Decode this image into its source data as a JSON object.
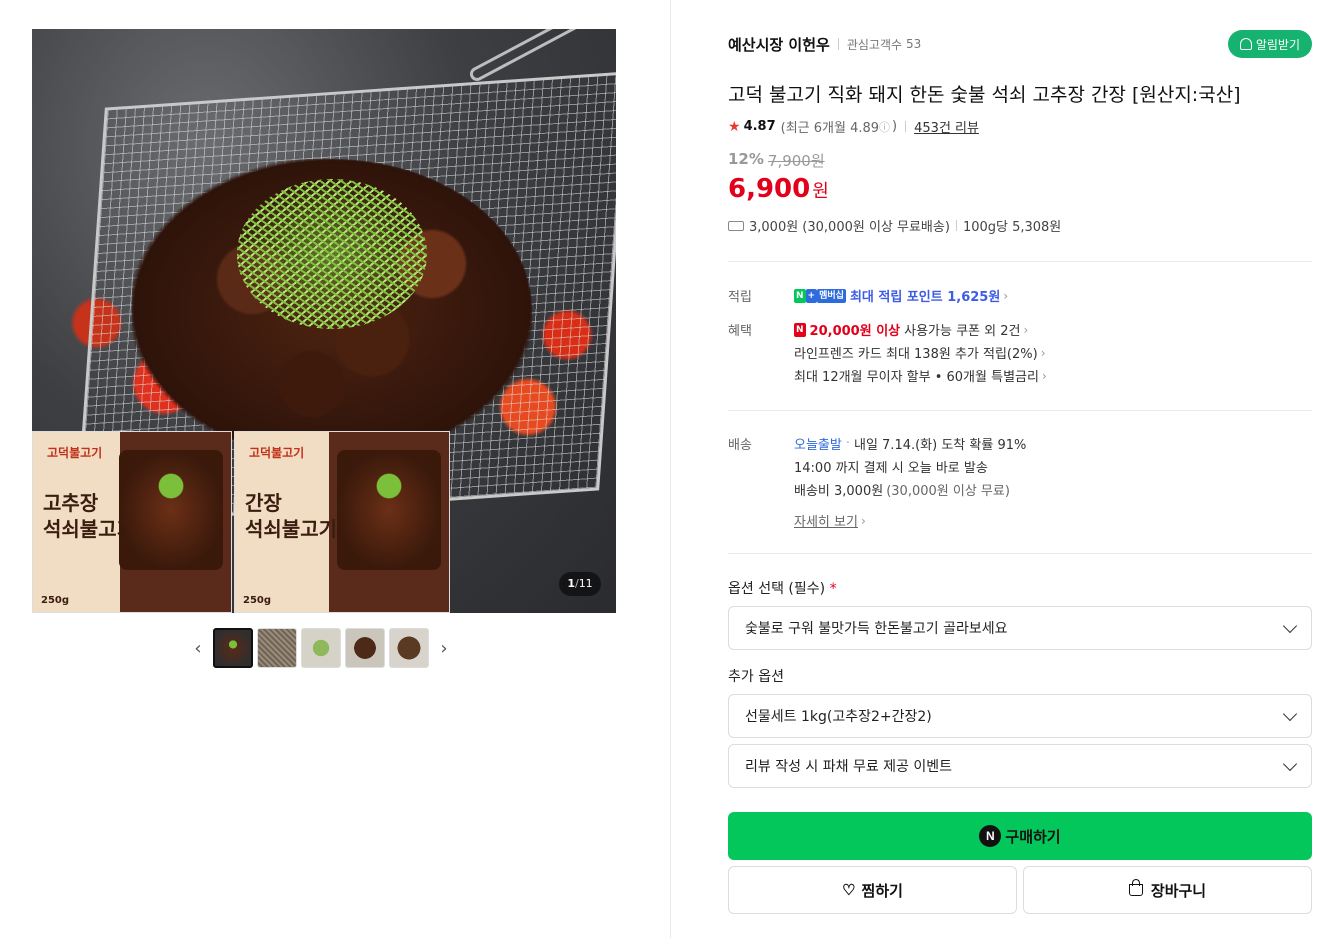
{
  "gallery": {
    "packs": [
      {
        "brand": "고덕불고기",
        "name_line1": "고추장",
        "name_line2": "석쇠불고기",
        "weight": "250g"
      },
      {
        "brand": "고덕불고기",
        "name_line1": "간장",
        "name_line2": "석쇠불고기",
        "weight": "250g"
      }
    ],
    "counter_current": "1",
    "counter_sep": "/",
    "counter_total": "11",
    "prev_icon": "chevron-left-icon",
    "next_icon": "chevron-right-icon"
  },
  "seller": {
    "name": "예산시장 이헌우",
    "interest_label": "관심고객수",
    "interest_count": "53",
    "notify_label": "알림받기"
  },
  "product": {
    "title": "고덕 불고기 직화 돼지 한돈 숯불 석쇠 고추장 간장 [원산지:국산]",
    "rating": "4.87",
    "recent_rating": "(최근 6개월 4.89",
    "recent_close": ")",
    "review_link": "453건 리뷰",
    "discount": "12%",
    "original_price": "7,900원",
    "price": "6,900",
    "currency": "원",
    "shipping": "3,000원 (30,000원 이상 무료배송)",
    "unit_price": "100g당 5,308원"
  },
  "benefits": {
    "points_label": "적립",
    "points_badge_n": "N",
    "points_badge_plus": "+",
    "points_badge_membership": "멤버십",
    "points_text": "최대 적립 포인트 1,625원",
    "benefit_label": "혜택",
    "coupon_badge": "N",
    "coupon_amount": "20,000원 이상",
    "coupon_text": "사용가능 쿠폰 외 2건",
    "card_text": "라인프렌즈 카드 최대 138원 추가 적립(2%)",
    "installment_text": "최대 12개월 무이자 할부 • 60개월 특별금리"
  },
  "delivery": {
    "label": "배송",
    "today": "오늘출발",
    "arrival": "내일 7.14.(화) 도착 확률 91%",
    "cutoff": "14:00 까지 결제 시 오늘 바로 발송",
    "fee": "배송비 3,000원",
    "fee_note": "(30,000원 이상 무료)",
    "detail_link": "자세히 보기"
  },
  "options": {
    "required_label": "옵션 선택 (필수)",
    "required_mark": "*",
    "required_value": "숯불로 구워 불맛가득 한돈불고기 골라보세요",
    "extra_label": "추가 옵션",
    "extra_1": "선물세트 1kg(고추장2+간장2)",
    "extra_2": "리뷰 작성 시 파채 무료 제공 이벤트"
  },
  "actions": {
    "buy_icon": "N",
    "buy_label": "구매하기",
    "wish_label": "찜하기",
    "cart_label": "장바구니"
  },
  "colors": {
    "accent_green": "#03c75a",
    "price_red": "#e2001a",
    "point_blue": "#3d5ce6",
    "notify_green": "#16b26f"
  }
}
